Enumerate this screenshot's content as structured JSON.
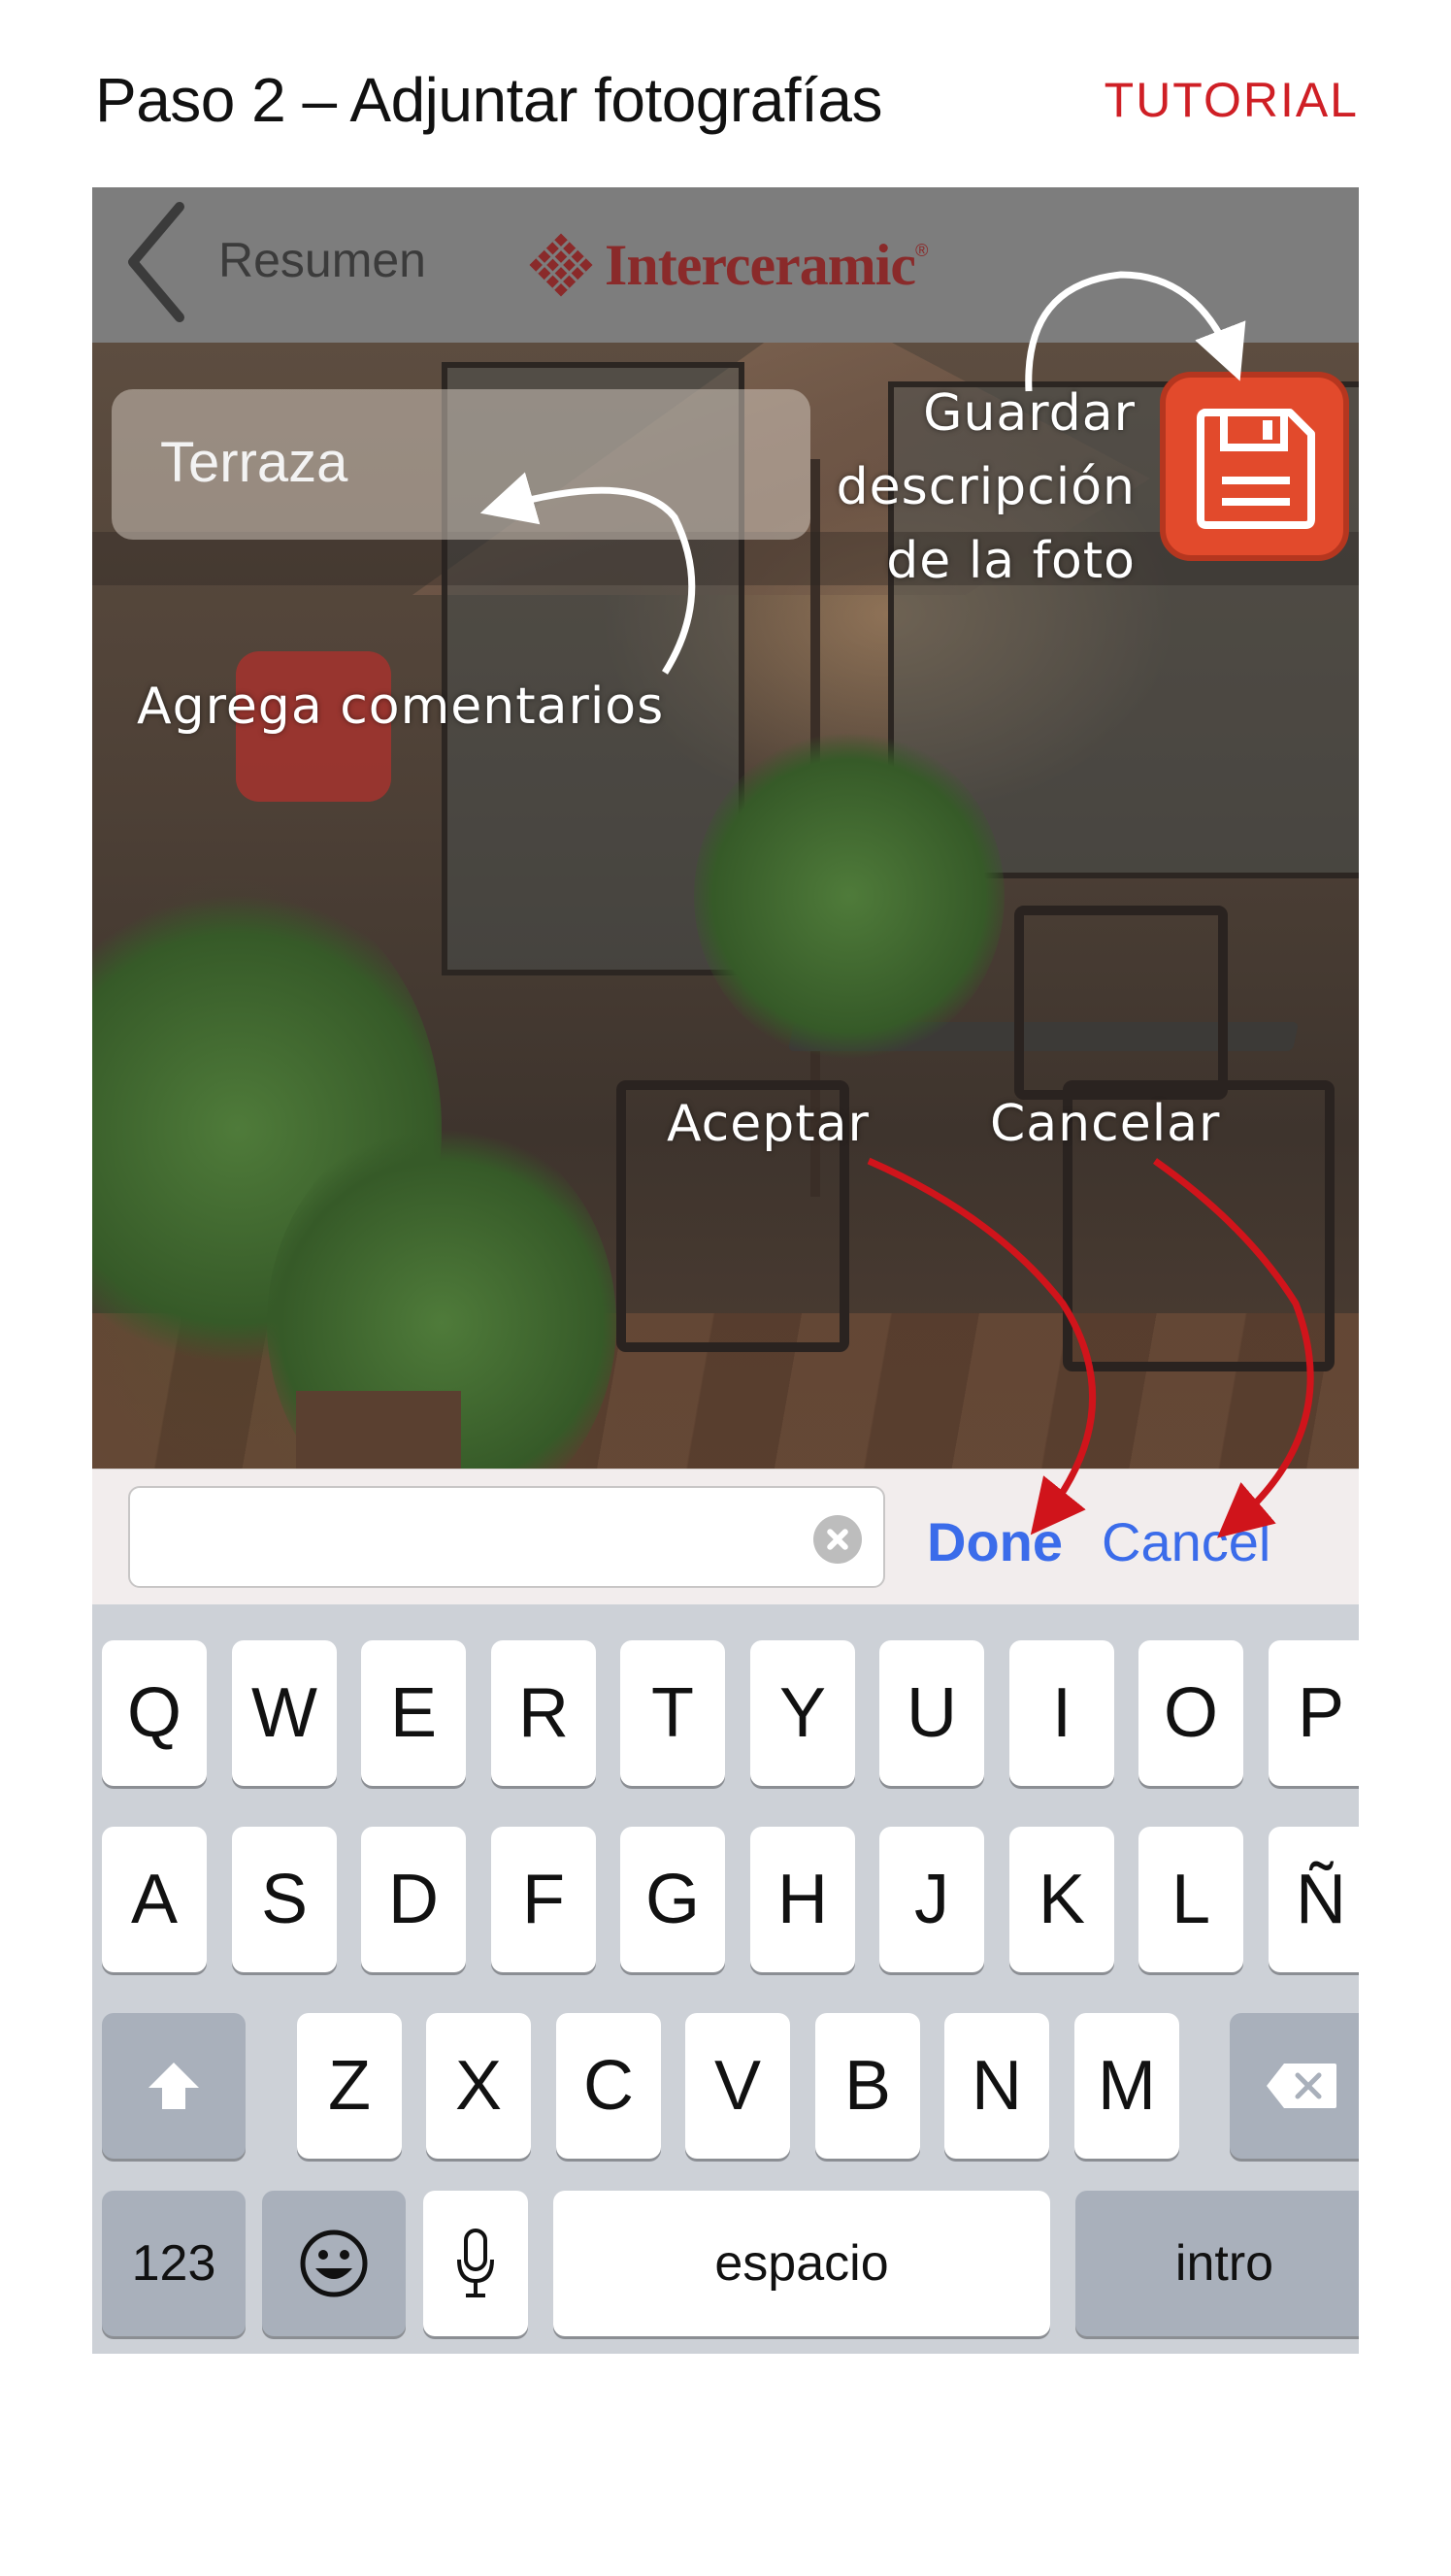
{
  "header": {
    "title": "Paso 2 – Adjuntar fotografías",
    "tutorial": "TUTORIAL"
  },
  "navbar": {
    "back_label": "Resumen",
    "logo_text": "Interceramic",
    "logo_mark": "®"
  },
  "photo_editor": {
    "title_value": "Terraza",
    "save_icon": "floppy-disk-icon"
  },
  "annotations": {
    "save_line1": "Guardar",
    "save_line2": "descripción",
    "save_line3": "de la foto",
    "comments": "Agrega comentarios",
    "accept": "Aceptar",
    "cancel": "Cancelar"
  },
  "accessory": {
    "search_value": "",
    "done": "Done",
    "cancel": "Cancel"
  },
  "keyboard": {
    "row1": [
      "Q",
      "W",
      "E",
      "R",
      "T",
      "Y",
      "U",
      "I",
      "O",
      "P"
    ],
    "row2": [
      "A",
      "S",
      "D",
      "F",
      "G",
      "H",
      "J",
      "K",
      "L",
      "Ñ"
    ],
    "row3": [
      "Z",
      "X",
      "C",
      "V",
      "B",
      "N",
      "M"
    ],
    "numbers": "123",
    "space": "espacio",
    "return": "intro",
    "shift_icon": "shift-arrow-icon",
    "delete_icon": "backspace-icon",
    "emoji_icon": "emoji-icon",
    "mic_icon": "microphone-icon"
  },
  "colors": {
    "accent_red": "#cf1f25",
    "ios_blue": "#3b6cea",
    "save_orange": "#e24a2c"
  }
}
